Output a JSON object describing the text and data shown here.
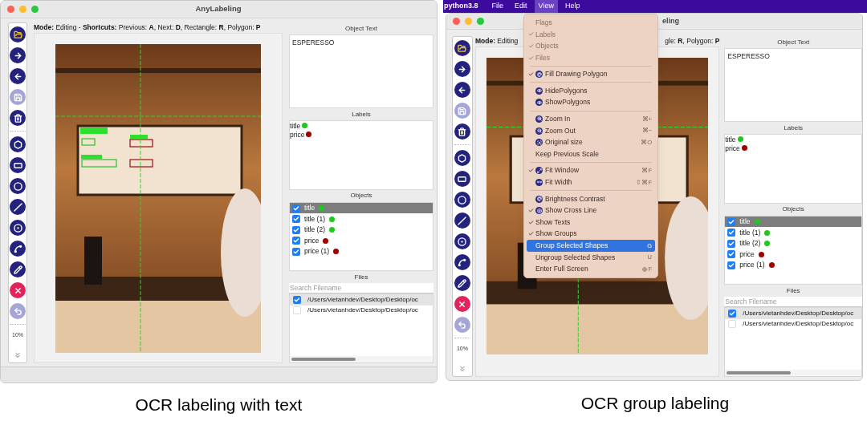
{
  "left": {
    "window": {
      "title": "AnyLabeling"
    },
    "mode_line": "**Mode:** Editing - **Shortcuts:** Previous: **A**, Next: **D**, Rectangle: **R**, Polygon: **P**",
    "toolbar": {
      "buttons": [
        {
          "disabled": false
        },
        {
          "disabled": false
        },
        {
          "disabled": false
        },
        {
          "disabled": true
        },
        {
          "disabled": false
        },
        {
          "disabled": false
        },
        {
          "disabled": false
        },
        {
          "disabled": false
        },
        {
          "disabled": false
        },
        {
          "disabled": false
        },
        {
          "disabled": false
        },
        {
          "disabled": false
        },
        {
          "disabled": false
        },
        {
          "disabled": true
        }
      ],
      "zoom": "10%"
    },
    "object_text": {
      "title": "Object Text",
      "value": "ESPERESSO"
    },
    "labels": {
      "title": "Labels",
      "items": [
        {
          "text": "title",
          "color": "#1ec81e"
        },
        {
          "text": "price",
          "color": "#a00000"
        }
      ]
    },
    "objects": {
      "title": "Objects",
      "items": [
        {
          "text": "title",
          "checked": true,
          "selected": true,
          "color": "#1ec81e"
        },
        {
          "text": "title (1)",
          "checked": true,
          "selected": false,
          "color": "#1ec81e"
        },
        {
          "text": "title (2)",
          "checked": true,
          "selected": false,
          "color": "#1ec81e"
        },
        {
          "text": "price",
          "checked": true,
          "selected": false,
          "color": "#a00000"
        },
        {
          "text": "price (1)",
          "checked": true,
          "selected": false,
          "color": "#a00000"
        }
      ]
    },
    "files": {
      "title": "Files",
      "placeholder": "Search Filename",
      "items": [
        {
          "path": "/Users/vietanhdev/Desktop/Desktop/oc",
          "checked": true,
          "selected": true
        },
        {
          "path": "/Users/vietanhdev/Desktop/Desktop/oc",
          "checked": false,
          "selected": false
        }
      ]
    },
    "caption": "OCR labeling with text"
  },
  "right": {
    "menu_bar": {
      "app": "python3.8",
      "items": [
        {
          "label": "File",
          "selected": false
        },
        {
          "label": "Edit",
          "selected": false
        },
        {
          "label": "View",
          "selected": true
        },
        {
          "label": "Help",
          "selected": false
        }
      ]
    },
    "view_menu": [
      {
        "kind": "item",
        "label": "Flags",
        "disabled": true,
        "checked": false,
        "icon": false,
        "selected": false
      },
      {
        "kind": "item",
        "label": "Labels",
        "disabled": true,
        "checked": true,
        "icon": false,
        "selected": false
      },
      {
        "kind": "item",
        "label": "Objects",
        "disabled": true,
        "checked": true,
        "icon": false,
        "selected": false
      },
      {
        "kind": "item",
        "label": "Files",
        "disabled": true,
        "checked": true,
        "icon": false,
        "selected": false
      },
      {
        "kind": "separator"
      },
      {
        "kind": "item",
        "label": "Fill Drawing Polygon",
        "disabled": false,
        "checked": true,
        "icon": true,
        "selected": false
      },
      {
        "kind": "separator"
      },
      {
        "kind": "item",
        "label": "HidePolygons",
        "disabled": false,
        "checked": false,
        "icon": true,
        "selected": false
      },
      {
        "kind": "item",
        "label": "ShowPolygons",
        "disabled": false,
        "checked": false,
        "icon": true,
        "selected": false
      },
      {
        "kind": "separator"
      },
      {
        "kind": "item",
        "label": "Zoom In",
        "disabled": false,
        "checked": false,
        "icon": true,
        "selected": false,
        "shortcut": "⌘+"
      },
      {
        "kind": "item",
        "label": "Zoom Out",
        "disabled": false,
        "checked": false,
        "icon": true,
        "selected": false,
        "shortcut": "⌘−"
      },
      {
        "kind": "item",
        "label": "Original size",
        "disabled": false,
        "checked": false,
        "icon": true,
        "selected": false,
        "shortcut": "⌘O"
      },
      {
        "kind": "item",
        "label": "Keep Previous Scale",
        "disabled": false,
        "checked": false,
        "icon": false,
        "selected": false
      },
      {
        "kind": "separator"
      },
      {
        "kind": "item",
        "label": "Fit Window",
        "disabled": false,
        "checked": true,
        "icon": true,
        "selected": false,
        "shortcut": "⌘F"
      },
      {
        "kind": "item",
        "label": "Fit Width",
        "disabled": false,
        "checked": false,
        "icon": true,
        "selected": false,
        "shortcut": "⇧⌘F"
      },
      {
        "kind": "separator"
      },
      {
        "kind": "item",
        "label": "Brightness Contrast",
        "disabled": false,
        "checked": false,
        "icon": true,
        "selected": false
      },
      {
        "kind": "item",
        "label": "Show Cross Line",
        "disabled": false,
        "checked": true,
        "icon": true,
        "selected": false
      },
      {
        "kind": "item",
        "label": "Show Texts",
        "disabled": false,
        "checked": true,
        "icon": false,
        "selected": false
      },
      {
        "kind": "item",
        "label": "Show Groups",
        "disabled": false,
        "checked": true,
        "icon": false,
        "selected": false
      },
      {
        "kind": "item",
        "label": "Group Selected Shapes",
        "disabled": false,
        "checked": false,
        "icon": false,
        "selected": true,
        "shortcut": "G"
      },
      {
        "kind": "item",
        "label": "Ungroup Selected Shapes",
        "disabled": false,
        "checked": false,
        "icon": false,
        "selected": false,
        "shortcut": "U"
      },
      {
        "kind": "item",
        "label": "Enter Full Screen",
        "disabled": false,
        "checked": false,
        "icon": false,
        "selected": false,
        "shortcut": "F",
        "shortcut_globe": true
      }
    ],
    "window": {
      "title": "eling"
    },
    "mode_line_start": "**Mode:** Editing",
    "mode_line_end": "gle: **R**, Polygon: **P**",
    "toolbar": {
      "buttons": [
        {
          "disabled": false
        },
        {
          "disabled": false
        },
        {
          "disabled": false
        },
        {
          "disabled": true
        },
        {
          "disabled": false
        },
        {
          "disabled": false
        },
        {
          "disabled": false
        },
        {
          "disabled": false
        },
        {
          "disabled": false
        },
        {
          "disabled": false
        },
        {
          "disabled": false
        },
        {
          "disabled": false
        },
        {
          "disabled": false
        },
        {
          "disabled": true
        }
      ],
      "zoom": "10%"
    },
    "object_text": {
      "title": "Object Text",
      "value": "ESPERESSO"
    },
    "labels": {
      "title": "Labels",
      "items": [
        {
          "text": "title",
          "color": "#1ec81e"
        },
        {
          "text": "price",
          "color": "#a00000"
        }
      ]
    },
    "objects": {
      "title": "Objects",
      "items": [
        {
          "text": "title",
          "checked": true,
          "selected": true,
          "color": "#1ec81e"
        },
        {
          "text": "title (1)",
          "checked": true,
          "selected": false,
          "color": "#1ec81e"
        },
        {
          "text": "title (2)",
          "checked": true,
          "selected": false,
          "color": "#1ec81e"
        },
        {
          "text": "price",
          "checked": true,
          "selected": false,
          "color": "#a00000"
        },
        {
          "text": "price (1)",
          "checked": true,
          "selected": false,
          "color": "#a00000"
        }
      ]
    },
    "files": {
      "title": "Files",
      "placeholder": "Search Filename",
      "items": [
        {
          "path": "/Users/vietanhdev/Desktop/Desktop/oc",
          "checked": true,
          "selected": true
        },
        {
          "path": "/Users/vietanhdev/Desktop/Desktop/oc",
          "checked": false,
          "selected": false
        }
      ]
    },
    "caption": "OCR group labeling"
  }
}
